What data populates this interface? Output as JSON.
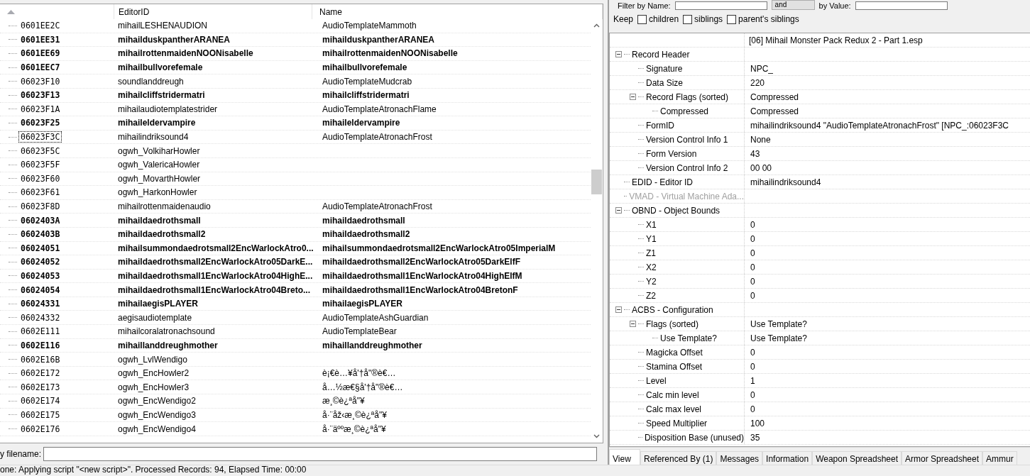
{
  "records": {
    "columns": [
      {
        "sorted": true
      },
      {
        "label": "EditorID",
        "sorted": false
      },
      {
        "label": "Name",
        "sorted": false
      }
    ],
    "rows": [
      {
        "formid": "0601EE2C",
        "editor_id": "mihailLESHENAUDION",
        "name": "AudioTemplateMammoth",
        "bold": false,
        "focused": false
      },
      {
        "formid": "0601EE31",
        "editor_id": "mihailduskpantherARANEA",
        "name": "mihailduskpantherARANEA",
        "bold": true,
        "focused": false
      },
      {
        "formid": "0601EE69",
        "editor_id": "mihailrottenmaidenNOONisabelle",
        "name": "mihailrottenmaidenNOONisabelle",
        "bold": true,
        "focused": false
      },
      {
        "formid": "0601EEC7",
        "editor_id": "mihailbullvorefemale",
        "name": "mihailbullvorefemale",
        "bold": true,
        "focused": false
      },
      {
        "formid": "06023F10",
        "editor_id": "soundlanddreugh",
        "name": "AudioTemplateMudcrab",
        "bold": false,
        "focused": false
      },
      {
        "formid": "06023F13",
        "editor_id": "mihailcliffstridermatri",
        "name": "mihailcliffstridermatri",
        "bold": true,
        "focused": false
      },
      {
        "formid": "06023F1A",
        "editor_id": "mihailaudiotemplatestrider",
        "name": "AudioTemplateAtronachFlame",
        "bold": false,
        "focused": false
      },
      {
        "formid": "06023F25",
        "editor_id": "mihaileldervampire",
        "name": "mihaileldervampire",
        "bold": true,
        "focused": false
      },
      {
        "formid": "06023F3C",
        "editor_id": "mihailindriksound4",
        "name": "AudioTemplateAtronachFrost",
        "bold": false,
        "focused": true
      },
      {
        "formid": "06023F5C",
        "editor_id": "ogwh_VolkiharHowler",
        "bold": false,
        "focused": false
      },
      {
        "formid": "06023F5F",
        "editor_id": "ogwh_ValericaHowler",
        "bold": false,
        "focused": false
      },
      {
        "formid": "06023F60",
        "editor_id": "ogwh_MovarthHowler",
        "bold": false,
        "focused": false
      },
      {
        "formid": "06023F61",
        "editor_id": "ogwh_HarkonHowler",
        "bold": false,
        "focused": false
      },
      {
        "formid": "06023F8D",
        "editor_id": "mihailrottenmaidenaudio",
        "name": "AudioTemplateAtronachFrost",
        "bold": false,
        "focused": false
      },
      {
        "formid": "0602403A",
        "editor_id": "mihaildaedrothsmall",
        "name": "mihaildaedrothsmall",
        "bold": true,
        "focused": false
      },
      {
        "formid": "0602403B",
        "editor_id": "mihaildaedrothsmall2",
        "name": "mihaildaedrothsmall2",
        "bold": true,
        "focused": false
      },
      {
        "formid": "06024051",
        "editor_id": "mihailsummondaedrotsmall2EncWarlockAtro0...",
        "name": "mihailsummondaedrotsmall2EncWarlockAtro05ImperialM",
        "bold": true,
        "focused": false
      },
      {
        "formid": "06024052",
        "editor_id": "mihaildaedrothsmall2EncWarlockAtro05DarkE...",
        "name": "mihaildaedrothsmall2EncWarlockAtro05DarkElfF",
        "bold": true,
        "focused": false
      },
      {
        "formid": "06024053",
        "editor_id": "mihaildaedrothsmall1EncWarlockAtro04HighE...",
        "name": "mihaildaedrothsmall1EncWarlockAtro04HighElfM",
        "bold": true,
        "focused": false
      },
      {
        "formid": "06024054",
        "editor_id": "mihaildaedrothsmall1EncWarlockAtro04Breto...",
        "name": "mihaildaedrothsmall1EncWarlockAtro04BretonF",
        "bold": true,
        "focused": false
      },
      {
        "formid": "06024331",
        "editor_id": "mihailaegisPLAYER",
        "name": "mihailaegisPLAYER",
        "bold": true,
        "focused": false
      },
      {
        "formid": "06024332",
        "editor_id": "aegisaudiotemplate",
        "name": "AudioTemplateAshGuardian",
        "bold": false,
        "focused": false
      },
      {
        "formid": "0602E111",
        "editor_id": "mihailcoralatronachsound",
        "name": "AudioTemplateBear",
        "bold": false,
        "focused": false
      },
      {
        "formid": "0602E116",
        "editor_id": "mihaillanddreughmother",
        "name": "mihaillanddreughmother",
        "bold": true,
        "focused": false
      },
      {
        "formid": "0602E16B",
        "editor_id": "ogwh_LvlWendigo",
        "bold": false,
        "focused": false
      },
      {
        "formid": "0602E172",
        "editor_id": "ogwh_EncHowler2",
        "name": "è¡€è…¥å'†å\"®è€…",
        "bold": false,
        "focused": false
      },
      {
        "formid": "0602E173",
        "editor_id": "ogwh_EncHowler3",
        "name": "å…½æ€§å'†å\"®è€…",
        "bold": false,
        "focused": false
      },
      {
        "formid": "0602E174",
        "editor_id": "ogwh_EncWendigo2",
        "name": "æ¸©è¿ªå\"¥",
        "bold": false,
        "focused": false
      },
      {
        "formid": "0602E175",
        "editor_id": "ogwh_EncWendigo3",
        "name": "å·¨åž‹æ¸©è¿ªå\"¥",
        "bold": false,
        "focused": false
      },
      {
        "formid": "0602E176",
        "editor_id": "ogwh_EncWendigo4",
        "name": "å·¨äººæ¸©è¿ªå\"¥",
        "bold": false,
        "focused": false
      }
    ]
  },
  "filename_filter": {
    "label": "y filename:"
  },
  "status_bar": "one: Applying script \"<new script>\". Processed Records: 94, Elapsed Time: 00:00",
  "filter": {
    "name_label": "Filter by Name:",
    "operator": "and",
    "value_label": "by Value:",
    "keep_label": "Keep",
    "keep_options": [
      {
        "label": "children",
        "checked": false
      },
      {
        "label": "siblings",
        "checked": false
      },
      {
        "label": "parent's siblings",
        "checked": false
      }
    ]
  },
  "record_view": {
    "header": "[06] Mihail Monster Pack Redux 2 - Part 1.esp",
    "fields": [
      {
        "label": "Record Header",
        "expanded": true,
        "disabled": false,
        "children": [
          {
            "label": "Signature",
            "value": "NPC_",
            "disabled": false
          },
          {
            "label": "Data Size",
            "value": "220",
            "disabled": false
          },
          {
            "label": "Record Flags (sorted)",
            "value": "Compressed",
            "expanded": true,
            "disabled": false,
            "children": [
              {
                "label": "Compressed",
                "value": "Compressed",
                "disabled": false
              }
            ]
          },
          {
            "label": "FormID",
            "value": "mihailindriksound4 \"AudioTemplateAtronachFrost\" [NPC_:06023F3C",
            "disabled": false
          },
          {
            "label": "Version Control Info 1",
            "value": "None",
            "disabled": false
          },
          {
            "label": "Form Version",
            "value": "43",
            "disabled": false
          },
          {
            "label": "Version Control Info 2",
            "value": "00 00",
            "disabled": false
          }
        ]
      },
      {
        "label": "EDID - Editor ID",
        "value": "mihailindriksound4",
        "disabled": false
      },
      {
        "label": "VMAD - Virtual Machine Ada...",
        "disabled": true
      },
      {
        "label": "OBND - Object Bounds",
        "expanded": true,
        "disabled": false,
        "children": [
          {
            "label": "X1",
            "value": "0",
            "disabled": false
          },
          {
            "label": "Y1",
            "value": "0",
            "disabled": false
          },
          {
            "label": "Z1",
            "value": "0",
            "disabled": false
          },
          {
            "label": "X2",
            "value": "0",
            "disabled": false
          },
          {
            "label": "Y2",
            "value": "0",
            "disabled": false
          },
          {
            "label": "Z2",
            "value": "0",
            "disabled": false
          }
        ]
      },
      {
        "label": "ACBS - Configuration",
        "expanded": true,
        "disabled": false,
        "children": [
          {
            "label": "Flags (sorted)",
            "value": "Use Template?",
            "expanded": true,
            "disabled": false,
            "children": [
              {
                "label": "Use Template?",
                "value": "Use Template?",
                "disabled": false
              }
            ]
          },
          {
            "label": "Magicka Offset",
            "value": "0",
            "disabled": false
          },
          {
            "label": "Stamina Offset",
            "value": "0",
            "disabled": false
          },
          {
            "label": "Level",
            "value": "1",
            "disabled": false
          },
          {
            "label": "Calc min level",
            "value": "0",
            "disabled": false
          },
          {
            "label": "Calc max level",
            "value": "0",
            "disabled": false
          },
          {
            "label": "Speed Multiplier",
            "value": "100",
            "disabled": false
          },
          {
            "label": "Disposition Base (unused)",
            "value": "35",
            "disabled": false
          }
        ]
      }
    ]
  },
  "tabs": [
    {
      "label": "View",
      "selected": true
    },
    {
      "label": "Referenced By (1)",
      "selected": false
    },
    {
      "label": "Messages",
      "selected": false
    },
    {
      "label": "Information",
      "selected": false
    },
    {
      "label": "Weapon Spreadsheet",
      "selected": false
    },
    {
      "label": "Armor Spreadsheet",
      "selected": false
    },
    {
      "label": "Ammur",
      "selected": false
    }
  ]
}
